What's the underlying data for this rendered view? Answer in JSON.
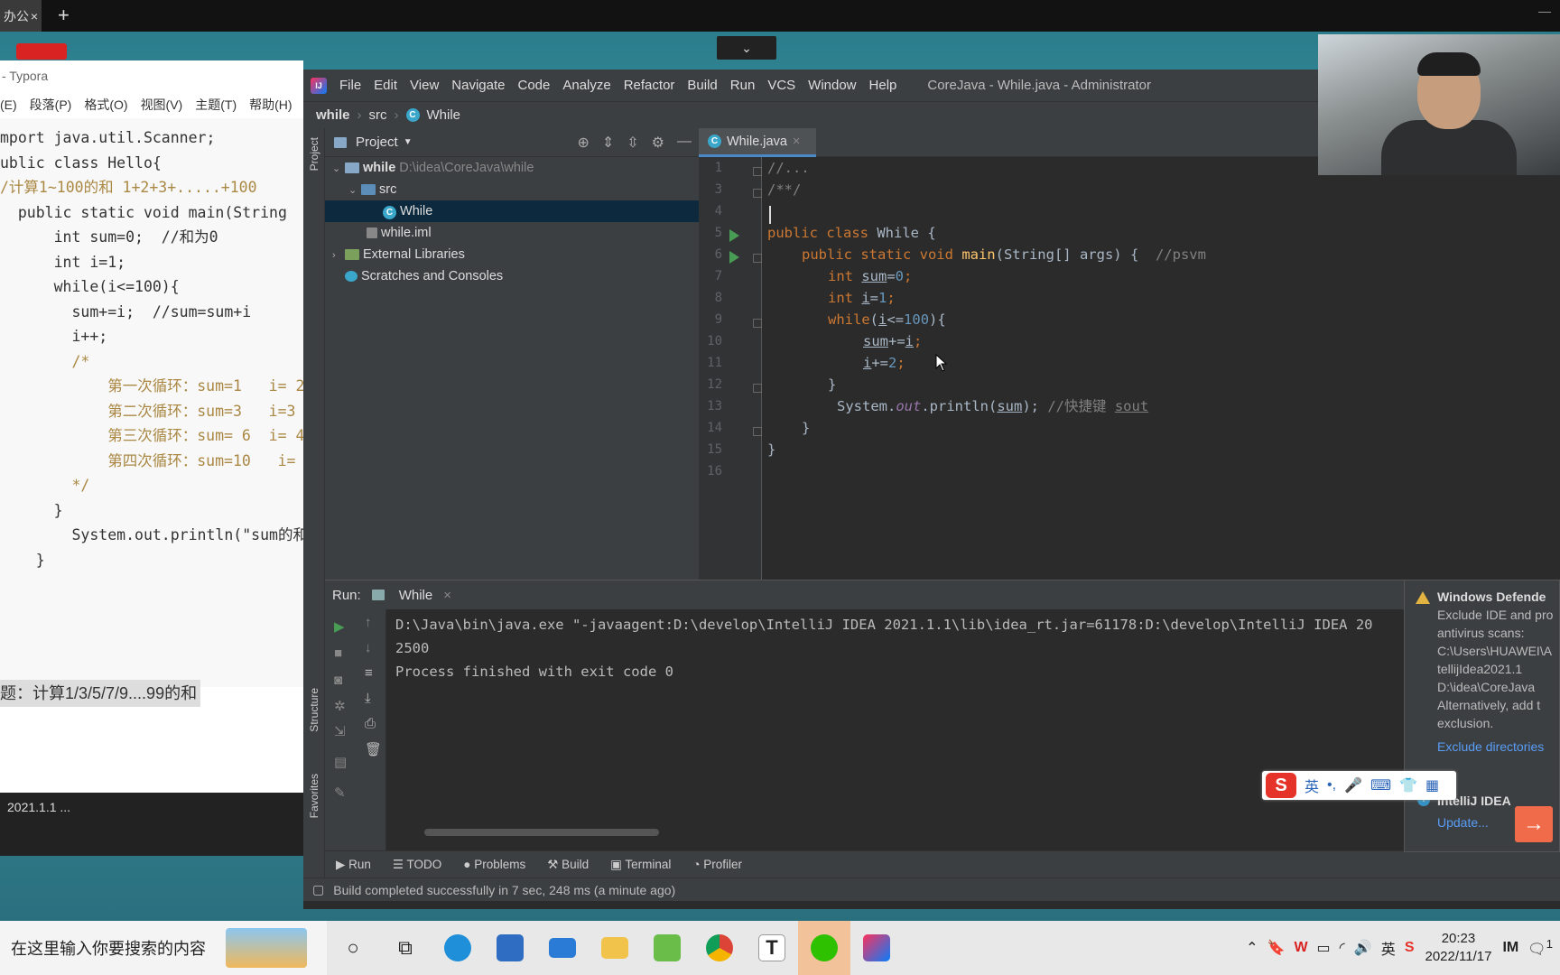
{
  "browser": {
    "tab_label": "办公",
    "tab_close": "×",
    "new_tab": "+",
    "min": "—"
  },
  "desktop": {
    "chevron": "⌄"
  },
  "typora": {
    "title": "- Typora",
    "menu": [
      "(E)",
      "段落(P)",
      "格式(O)",
      "视图(V)",
      "主题(T)",
      "帮助(H)"
    ],
    "code_lines": [
      "mport java.util.Scanner;",
      "",
      "ublic class Hello{",
      "/计算1~100的和 1+2+3+.....+100",
      "  public static void main(String",
      "      int sum=0;  //和为0",
      "      int i=1;",
      "      while(i<=100){",
      "        sum+=i;  //sum=sum+i",
      "        i++;",
      "        /*",
      "            第一次循环：sum=1   i= 2",
      "            第二次循环：sum=3   i=3",
      "            第三次循环：sum= 6  i= 4",
      "            第四次循环：sum=10   i=",
      "        */",
      "      }",
      "        System.out.println(\"sum的和",
      "",
      "    }"
    ],
    "task": "题：计算1/3/5/7/9....99的和",
    "status": "2021.1.1 ..."
  },
  "idea": {
    "menu": [
      "File",
      "Edit",
      "View",
      "Navigate",
      "Code",
      "Analyze",
      "Refactor",
      "Build",
      "Run",
      "VCS",
      "Window",
      "Help"
    ],
    "window_title": "CoreJava - While.java - Administrator",
    "breadcrumb": [
      "while",
      "src",
      "While"
    ],
    "sidebar_project": "Project",
    "sidebar_structure": "Structure",
    "sidebar_favorites": "Favorites",
    "project_header": "Project",
    "tree": {
      "root": "while",
      "root_path": "D:\\idea\\CoreJava\\while",
      "src": "src",
      "class": "While",
      "iml": "while.iml",
      "ext_libs": "External Libraries",
      "scratches": "Scratches and Consoles"
    },
    "editor_tab": "While.java",
    "line_numbers": [
      "1",
      "3",
      "4",
      "5",
      "6",
      "7",
      "8",
      "9",
      "10",
      "11",
      "12",
      "13",
      "14",
      "15",
      "16"
    ],
    "code": {
      "l1": "//...",
      "l3": "/**/",
      "l5_kw": "public class ",
      "l5_name": "While {",
      "l6_kw": "public static void ",
      "l6_fn": "main",
      "l6_rest": "(String[] args) {  ",
      "l6_cm": "//psvm",
      "l7_kw": "int ",
      "l7_var": "sum",
      "l7_eq": "=",
      "l7_num": "0",
      "l7_end": ";",
      "l8_kw": "int ",
      "l8_var": "i",
      "l8_eq": "=",
      "l8_num": "1",
      "l8_end": ";",
      "l9_kw": "while",
      "l9_a": "(",
      "l9_var": "i",
      "l9_b": "<=",
      "l9_num": "100",
      "l9_c": "){",
      "l10_var": "sum",
      "l10_op": "+=",
      "l10_var2": "i",
      "l10_end": ";",
      "l11_var": "i",
      "l11_op": "+=",
      "l11_num": "2",
      "l11_end": ";",
      "l12": "}",
      "l13_a": "System.",
      "l13_out": "out",
      "l13_b": ".println(",
      "l13_var": "sum",
      "l13_c": "); ",
      "l13_cm": "//快捷键 ",
      "l13_cm2": "sout",
      "l14": "}",
      "l15": "}"
    },
    "run_label": "Run:",
    "run_tab": "While",
    "console": [
      "D:\\Java\\bin\\java.exe \"-javaagent:D:\\develop\\IntelliJ IDEA 2021.1.1\\lib\\idea_rt.jar=61178:D:\\develop\\IntelliJ IDEA 20",
      "2500",
      "",
      "Process finished with exit code 0"
    ],
    "bottom_tabs": [
      "Run",
      "TODO",
      "Problems",
      "Build",
      "Terminal",
      "Profiler"
    ],
    "status": "Build completed successfully in 7 sec, 248 ms (a minute ago)"
  },
  "notifications": {
    "defender_title": "Windows Defende",
    "defender_body": [
      "Exclude IDE and pro",
      "antivirus scans:",
      "C:\\Users\\HUAWEI\\A",
      "tellijIdea2021.1",
      "D:\\idea\\CoreJava",
      "Alternatively, add t",
      "exclusion."
    ],
    "defender_link": "Exclude directories",
    "idea_title": "IntelliJ IDEA",
    "idea_link": "Update..."
  },
  "ime": {
    "logo": "S",
    "items": [
      "英",
      "•,",
      "🎤",
      "⌨",
      "👕",
      "▦"
    ]
  },
  "taskbar": {
    "search_placeholder": "在这里输入你要搜索的内容",
    "time": "20:23",
    "date": "2022/11/17",
    "badge": "1"
  },
  "colors": {
    "accent": "#4a88c7",
    "run_green": "#499c54",
    "keyword": "#cc7832",
    "number": "#6897bb"
  }
}
